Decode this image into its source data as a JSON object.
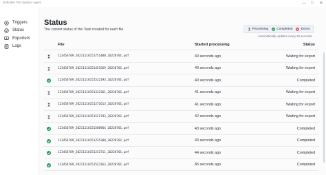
{
  "app": {
    "title": "Hotfolder File System Agent"
  },
  "window": {
    "minimize": "—",
    "maximize": "□",
    "close": "✕"
  },
  "sidebar": {
    "items": [
      {
        "label": "Triggers",
        "icon": "triggers-icon"
      },
      {
        "label": "Status",
        "icon": "status-icon"
      },
      {
        "label": "Exporters",
        "icon": "exporters-icon"
      },
      {
        "label": "Logs",
        "icon": "logs-icon"
      }
    ]
  },
  "header": {
    "title": "Status",
    "subtitle": "The current status of the Task created for each file."
  },
  "legend": {
    "items": [
      {
        "label": "Processing",
        "icon": "hourglass-icon"
      },
      {
        "label": "Completed",
        "icon": "check-circle-icon"
      },
      {
        "label": "Errors",
        "icon": "error-circle-icon"
      }
    ],
    "note": "Automatically updates every 10 seconds"
  },
  "table": {
    "columns": [
      "File",
      "Started processing",
      "Status"
    ],
    "rows": [
      {
        "state": "processing",
        "file": "123456789_20211110151751400_20220701.pdf",
        "started": "40 seconds ago",
        "status": "Waiting for export"
      },
      {
        "state": "processing",
        "file": "123456789_20211110151451569_20220701.pdf",
        "started": "40 seconds ago",
        "status": "Waiting for export"
      },
      {
        "state": "completed",
        "file": "123456789_20211110151522193_20220701.pdf",
        "started": "40 seconds ago",
        "status": "Completed"
      },
      {
        "state": "processing",
        "file": "123456789_20211110151312361_20220701.pdf",
        "started": "41 seconds ago",
        "status": "Waiting for export"
      },
      {
        "state": "processing",
        "file": "123456789_20211110151271613_20220701.pdf",
        "started": "41 seconds ago",
        "status": "Waiting for export"
      },
      {
        "state": "processing",
        "file": "123456789_20211110151521793_20220701.pdf",
        "started": "42 seconds ago",
        "status": "Waiting for export"
      },
      {
        "state": "completed",
        "file": "123456789_20211110151500964_20220701.pdf",
        "started": "43 seconds ago",
        "status": "Completed"
      },
      {
        "state": "completed",
        "file": "123456789_20211110151235300_20220701.pdf",
        "started": "43 seconds ago",
        "status": "Completed"
      },
      {
        "state": "completed",
        "file": "123456789_20211110151231711_20220701.pdf",
        "started": "44 seconds ago",
        "status": "Completed"
      },
      {
        "state": "completed",
        "file": "123456789_20211110151522163_20220701.pdf",
        "started": "45 seconds ago",
        "status": "Completed"
      }
    ]
  },
  "colors": {
    "completed": "#1f9d55",
    "error": "#d64545",
    "processing": "#4a4f56",
    "accent_bg": "#eef2f8"
  }
}
